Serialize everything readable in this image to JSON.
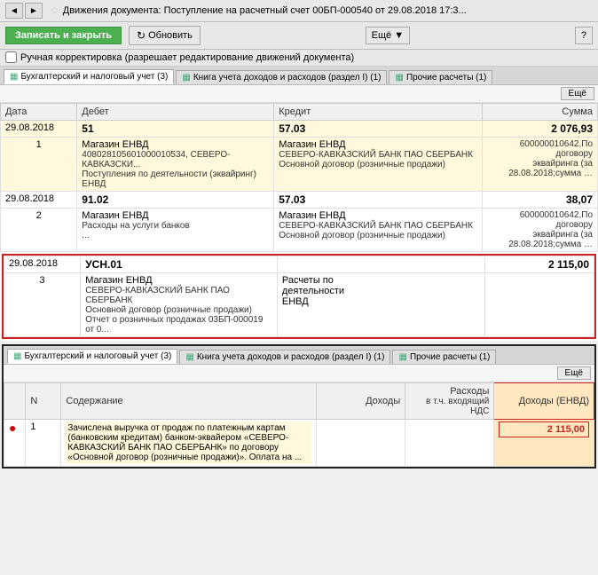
{
  "titleBar": {
    "title": "Движения документа: Поступление на расчетный счет 00БП-000540 от 29.08.2018 17:3...",
    "navBack": "◄",
    "navForward": "►",
    "star": "☆"
  },
  "toolbar": {
    "saveClose": "Записать и закрыть",
    "refresh": "Обновить",
    "more": "Ещё ▼",
    "help": "?"
  },
  "checkbox": {
    "label": "Ручная корректировка (разрешает редактирование движений документа)"
  },
  "tabs": [
    {
      "label": "Бухгалтерский и налоговый учет (3)",
      "active": true
    },
    {
      "label": "Книга учета доходов и расходов (раздел I) (1)",
      "active": false
    },
    {
      "label": "Прочие расчеты (1)",
      "active": false
    }
  ],
  "tableMore": "Ещё",
  "tableHeaders": {
    "date": "Дата",
    "debit": "Дебет",
    "credit": "Кредит",
    "amount": "Сумма"
  },
  "tableRows": [
    {
      "date": "29.08.2018",
      "rowNum": "",
      "debit": "51",
      "credit": "57.03",
      "amount": "2 076,93",
      "highlighted": true,
      "subRows": [
        {
          "rowNum": "1",
          "debit": "Магазин ЕНВД",
          "credit": "Магазин ЕНВД",
          "amount": "600000010642.По договору эквайринга (за 28.08.2018;сумма …",
          "debitSub": "408028105601000010534, СЕВЕРО-КАВКАЗСКИ...",
          "creditSub": "СЕВЕРО-КАВКАЗСКИЙ БАНК ПАО СБЕРБАНК",
          "debitSub2": "Поступления по деятельности (эквайринг) ЕНВД",
          "creditSub2": "Основной договор (розничные продажи)"
        }
      ]
    },
    {
      "date": "29.08.2018",
      "rowNum": "",
      "debit": "91.02",
      "credit": "57.03",
      "amount": "38,07",
      "highlighted": false,
      "subRows": [
        {
          "rowNum": "2",
          "debit": "Магазин ЕНВД",
          "credit": "Магазин ЕНВД",
          "amount": "600000010642.По договору эквайринга (за 28.08.2018;сумма …",
          "debitSub": "Расходы на услуги банков",
          "creditSub": "СЕВЕРО-КАВКАЗСКИЙ БАНК ПАО СБЕРБАНК",
          "debitSub2": "...",
          "creditSub2": "Основной договор (розничные продажи)"
        }
      ]
    },
    {
      "date": "29.08.2018",
      "rowNum": "",
      "debit": "УСН.01",
      "credit": "",
      "amount": "2 115,00",
      "highlighted": false,
      "redBorder": true,
      "subRows": [
        {
          "rowNum": "3",
          "debit": "Магазин ЕНВД",
          "credit": "Расчеты по деятельности ЕНВД",
          "amount": "",
          "debitSub": "СЕВЕРО-КАВКАЗСКИЙ БАНК ПАО СБЕРБАНК",
          "creditSub": "",
          "debitSub2": "Основной договор (розничные продажи)",
          "creditSub2": "",
          "debitSub3": "Отчет о розничных продажах 03БП-000019 от 0..."
        }
      ]
    }
  ],
  "bottomSection": {
    "tabs": [
      {
        "label": "Бухгалтерский и налоговый учет (3)",
        "active": true
      },
      {
        "label": "Книга учета доходов и расходов (раздел I) (1)",
        "active": false
      },
      {
        "label": "Прочие расчеты (1)",
        "active": false
      }
    ],
    "more": "Ещё",
    "headers": {
      "n": "N",
      "content": "Содержание",
      "income": "Доходы",
      "expenses": "Расходы",
      "expensesSub": "в т.ч. входящий НДС",
      "incomeEnvd": "Доходы (ЕНВД)"
    },
    "rows": [
      {
        "dot": "●",
        "num": "1",
        "content": "Зачислена выручка от продаж по платежным картам (банковским кредитам) банком-эквайером «СЕВЕРО-КАВКАЗСКИЙ БАНК ПАО СБЕРБАНК» по договору «Основной договор (розничные продажи)». Оплата на ...",
        "income": "",
        "expenses": "",
        "incomeEnvd": "2 115,00"
      }
    ]
  }
}
